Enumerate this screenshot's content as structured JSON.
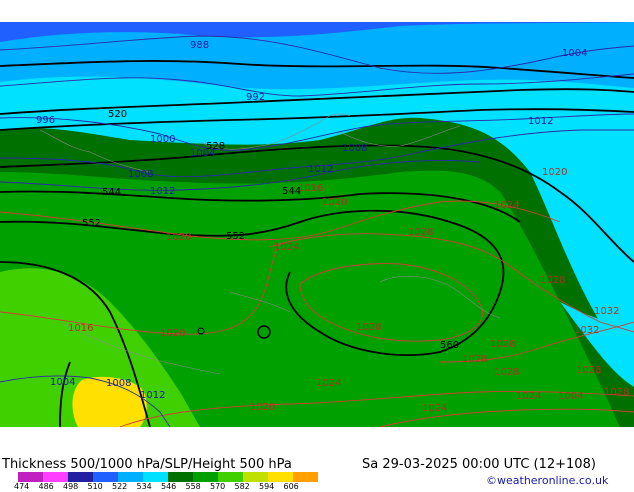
{
  "title": "Thickness 500/1000 hPa/SLP/Height 500 hPa",
  "datetime": "Sa 29-03-2025 00:00 UTC (12+108)",
  "credit": "©weatheronline.co.uk",
  "scale": {
    "ticks": [
      "474",
      "486",
      "498",
      "510",
      "522",
      "534",
      "546",
      "558",
      "570",
      "582",
      "594",
      "606"
    ],
    "colors": [
      "#c020c0",
      "#ff40ff",
      "#2020a0",
      "#2060ff",
      "#00b0ff",
      "#00e0ff",
      "#007000",
      "#00a000",
      "#40d000",
      "#c0e000",
      "#ffe000",
      "#ffa000"
    ]
  },
  "pressure_labels": [
    {
      "text": "988"
    },
    {
      "text": "992"
    },
    {
      "text": "996"
    },
    {
      "text": "1000"
    },
    {
      "text": "1004"
    },
    {
      "text": "1004"
    },
    {
      "text": "1008"
    },
    {
      "text": "1008"
    },
    {
      "text": "1012"
    },
    {
      "text": "1012"
    },
    {
      "text": "1012"
    },
    {
      "text": "1016"
    },
    {
      "text": "1020"
    },
    {
      "text": "1020"
    },
    {
      "text": "1024"
    },
    {
      "text": "1024"
    },
    {
      "text": "1028"
    },
    {
      "text": "1028"
    },
    {
      "text": "1028"
    },
    {
      "text": "1032"
    },
    {
      "text": "1032"
    },
    {
      "text": "1020"
    },
    {
      "text": "1016"
    },
    {
      "text": "1020"
    },
    {
      "text": "1024"
    },
    {
      "text": "1020"
    },
    {
      "text": "1028"
    },
    {
      "text": "1028"
    },
    {
      "text": "1024"
    },
    {
      "text": "1024"
    },
    {
      "text": "1028"
    },
    {
      "text": "1028"
    },
    {
      "text": "1004"
    },
    {
      "text": "1008"
    },
    {
      "text": "1012"
    },
    {
      "text": "1004"
    },
    {
      "text": "1028"
    }
  ],
  "height_labels": [
    {
      "text": "520"
    },
    {
      "text": "528"
    },
    {
      "text": "544"
    },
    {
      "text": "544"
    },
    {
      "text": "552"
    },
    {
      "text": "552"
    },
    {
      "text": "560"
    }
  ],
  "colors": {
    "band_blue_deep": "#2060ff",
    "band_blue": "#00b0ff",
    "band_cyan": "#00e0ff",
    "band_green_dark": "#007000",
    "band_green": "#00a000",
    "band_green_light": "#40d000",
    "band_yellow": "#ffe000"
  }
}
